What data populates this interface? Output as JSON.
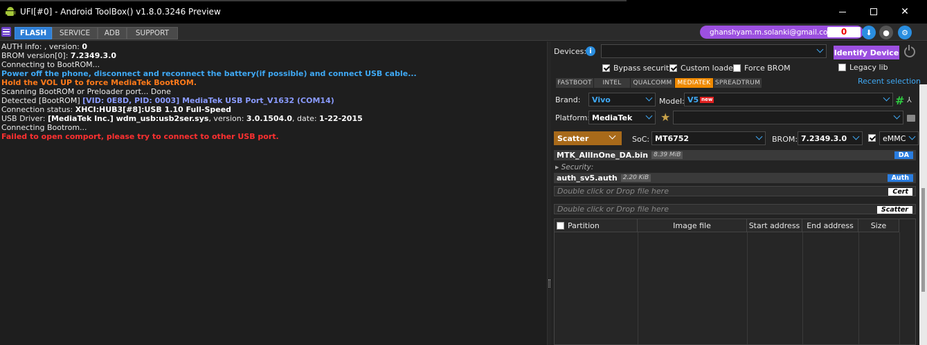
{
  "window": {
    "title": "UFI[#0] - Android ToolBox() v1.8.0.3246 Preview",
    "minimize": "",
    "maximize": "",
    "close": "✕"
  },
  "toolbar": {
    "tabs": [
      {
        "label": "FLASH",
        "active": true
      },
      {
        "label": "SERVICE",
        "active": false
      },
      {
        "label": "ADB",
        "active": false
      },
      {
        "label": "SUPPORT",
        "active": false
      }
    ],
    "user_email": "ghanshyam.m.solanki@gmail.com",
    "counter": "0"
  },
  "log": {
    "lines": [
      [
        {
          "t": "AUTH info: , version: "
        },
        {
          "t": "0",
          "c": "bold"
        }
      ],
      [
        {
          "t": "BROM version[0]: "
        },
        {
          "t": "7.2349.3.0",
          "c": "bold"
        }
      ],
      [
        {
          "t": "Connecting to BootROM..."
        }
      ],
      [
        {
          "t": " Power off the phone, disconnect and reconnect the battery(if possible) and connect USB cable...",
          "c": "blue"
        }
      ],
      [
        {
          "t": " Hold the VOL UP to force MediaTek BootROM.",
          "c": "orange"
        }
      ],
      [
        {
          "t": " Scanning BootROM or Preloader port... Done"
        }
      ],
      [
        {
          "t": " Detected [BootROM] "
        },
        {
          "t": "[VID: 0E8D, PID: 0003] MediaTek USB Port_V1632 (COM14)",
          "c": "lblue"
        }
      ],
      [
        {
          "t": "Connection status: "
        },
        {
          "t": "XHCI:HUB3[#8]:USB 1.10 Full-Speed",
          "c": "bold"
        }
      ],
      [
        {
          "t": " USB Driver: "
        },
        {
          "t": "[MediaTek Inc.] wdm_usb:usb2ser.sys",
          "c": "bold"
        },
        {
          "t": ", version: "
        },
        {
          "t": "3.0.1504.0",
          "c": "bold"
        },
        {
          "t": ", date: "
        },
        {
          "t": "1-22-2015",
          "c": "bold"
        }
      ],
      [
        {
          "t": "Connecting Bootrom..."
        }
      ],
      [
        {
          "t": "Failed to open comport, please try to connect to other USB port.",
          "c": "red"
        }
      ]
    ]
  },
  "devices": {
    "label": "Devices:",
    "value": "",
    "identify_label": "Identify Device"
  },
  "options": {
    "bypass_security": {
      "label": "Bypass security",
      "checked": true
    },
    "custom_loader": {
      "label": "Custom loader",
      "checked": true
    },
    "force_brom": {
      "label": "Force BROM",
      "checked": false
    },
    "legacy_lib": {
      "label": "Legacy lib",
      "checked": false
    }
  },
  "platform_tabs": [
    {
      "label": "FASTBOOT",
      "active": false
    },
    {
      "label": "INTEL",
      "active": false
    },
    {
      "label": "QUALCOMM",
      "active": false
    },
    {
      "label": "MEDIATEK",
      "active": true
    },
    {
      "label": "SPREADTRUM",
      "active": false
    }
  ],
  "recent_selection": "Recent selection",
  "brand": {
    "label": "Brand:",
    "value": "Vivo"
  },
  "model": {
    "label": "Model:",
    "value": "V5",
    "badge": "new"
  },
  "platform": {
    "label": "Platform:",
    "value": "MediaTek",
    "extra": ""
  },
  "scatter_mode": "Scatter",
  "soc": {
    "label": "SoC:",
    "value": "MT6752"
  },
  "brom": {
    "label": "BROM:",
    "value": "7.2349.3.0"
  },
  "storage": {
    "value": "eMMC",
    "checked": true
  },
  "files": {
    "da": {
      "name": "MTK_AllInOne_DA.bin",
      "size": "8.39 MiB",
      "tag": "DA"
    },
    "security_label": "Security:",
    "auth": {
      "name": "auth_sv5.auth",
      "size": "2.20 KiB",
      "tag": "Auth"
    },
    "cert": {
      "placeholder": "Double click or Drop file here",
      "tag": "Cert"
    },
    "scatter": {
      "placeholder": "Double click or Drop file here",
      "tag": "Scatter"
    }
  },
  "table": {
    "headers": [
      "Partition",
      "Image file",
      "Start address",
      "End address",
      "Size"
    ]
  },
  "colors": {
    "accent_blue": "#2f7fd6",
    "purple": "#9c50e0",
    "mediatek_orange": "#f08a00",
    "scatter_brown": "#a86a1a",
    "error_red": "#ff3030"
  }
}
